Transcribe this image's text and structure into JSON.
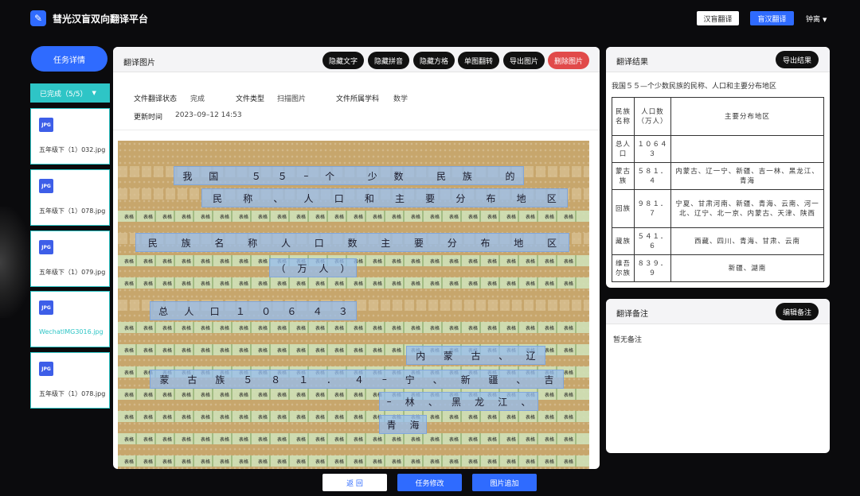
{
  "header": {
    "app_title": "彗光汉盲双向翻译平台",
    "btn_han_to_braille": "汉盲翻译",
    "btn_braille_to_han": "盲汉翻译",
    "user_name": "钟离",
    "logo_icon": "feather-icon"
  },
  "sidebar": {
    "task_detail": "任务详情",
    "done_filter": "已完成（5/5）",
    "files": [
      {
        "type": "JPG",
        "name": "五年级下（1）032.jpg"
      },
      {
        "type": "JPG",
        "name": "五年级下（1）078.jpg"
      },
      {
        "type": "JPG",
        "name": "五年级下（1）079.jpg"
      },
      {
        "type": "JPG",
        "name": "WechatIMG3016.jpg"
      },
      {
        "type": "JPG",
        "name": "五年级下（1）078.jpg"
      }
    ]
  },
  "translate_panel": {
    "title": "翻译图片",
    "actions": {
      "hide_text": "隐藏文字",
      "hide_pinyin": "隐藏拼音",
      "hide_grid": "隐藏方格",
      "single_flip": "单图翻转",
      "export_image": "导出图片",
      "delete_image": "删除图片"
    },
    "meta": {
      "status_label": "文件翻译状态",
      "status_value": "完成",
      "type_label": "文件类型",
      "type_value": "扫描图片",
      "subject_label": "文件所属学科",
      "subject_value": "数学",
      "updated_label": "更新时间",
      "updated_value": "2023–09–12 14:53"
    },
    "scan": {
      "grid_tag": "表格",
      "rows": [
        {
          "text": [
            "我",
            "国",
            "",
            "５",
            "５",
            "–",
            "个",
            "",
            "少",
            "数",
            "",
            "民",
            "族",
            "",
            "的"
          ]
        },
        {
          "text": [
            "民",
            "称",
            "、",
            "人",
            "口",
            "和",
            "主",
            "要",
            "分",
            "布",
            "地",
            "区"
          ]
        },
        {
          "text": [
            "民",
            "族",
            "名",
            "称",
            "人",
            "口",
            "数",
            "主",
            "要",
            "分",
            "布",
            "地",
            "区"
          ]
        },
        {
          "text": [
            "（",
            "万",
            "人",
            "）"
          ]
        },
        {
          "text": [
            "总",
            "人",
            "口",
            "１",
            "０",
            "６",
            "４",
            "３"
          ]
        },
        {
          "text": [
            "内",
            "蒙",
            "古",
            "、",
            "辽"
          ]
        },
        {
          "text": [
            "蒙",
            "古",
            "族",
            "５",
            "８",
            "１",
            "．",
            "４",
            "–",
            "宁",
            "、",
            "新",
            "疆",
            "、",
            "吉"
          ]
        },
        {
          "text": [
            "–",
            "林",
            "、",
            "黑",
            "龙",
            "江",
            "、"
          ]
        },
        {
          "text": [
            "青",
            "海"
          ]
        }
      ]
    }
  },
  "result_panel": {
    "title": "翻译结果",
    "export_btn": "导出结果",
    "summary": "我国５５—个少数民族的民称、人口和主要分布地区",
    "table": {
      "headers": [
        "民族名称",
        "人口数（万人）",
        "主要分布地区"
      ],
      "rows": [
        [
          "总人口",
          "１０６４３",
          ""
        ],
        [
          "蒙古族",
          "５８１．４",
          "内蒙古、辽一宁、新疆、吉一林、黑龙江、青海"
        ],
        [
          "回族",
          "９８１．７",
          "宁夏、甘肃河南、新疆、青海、云南、河一北、辽宁、北一京、内蒙古、天津、陕西"
        ],
        [
          "藏族",
          "５４１．６",
          "西藏、四川、青海、甘肃、云南"
        ],
        [
          "维吾尔族",
          "８３９．９",
          "新疆、湖南"
        ]
      ]
    }
  },
  "note_panel": {
    "title": "翻译备注",
    "edit_btn": "编辑备注",
    "content": "暂无备注"
  },
  "footer": {
    "back": "返 回",
    "edit_task": "任务修改",
    "add_image": "图片追加"
  },
  "colors": {
    "accent": "#2f6bff",
    "teal": "#2ec5c6",
    "danger": "#e14a4a",
    "background": "#0b0b0d"
  }
}
